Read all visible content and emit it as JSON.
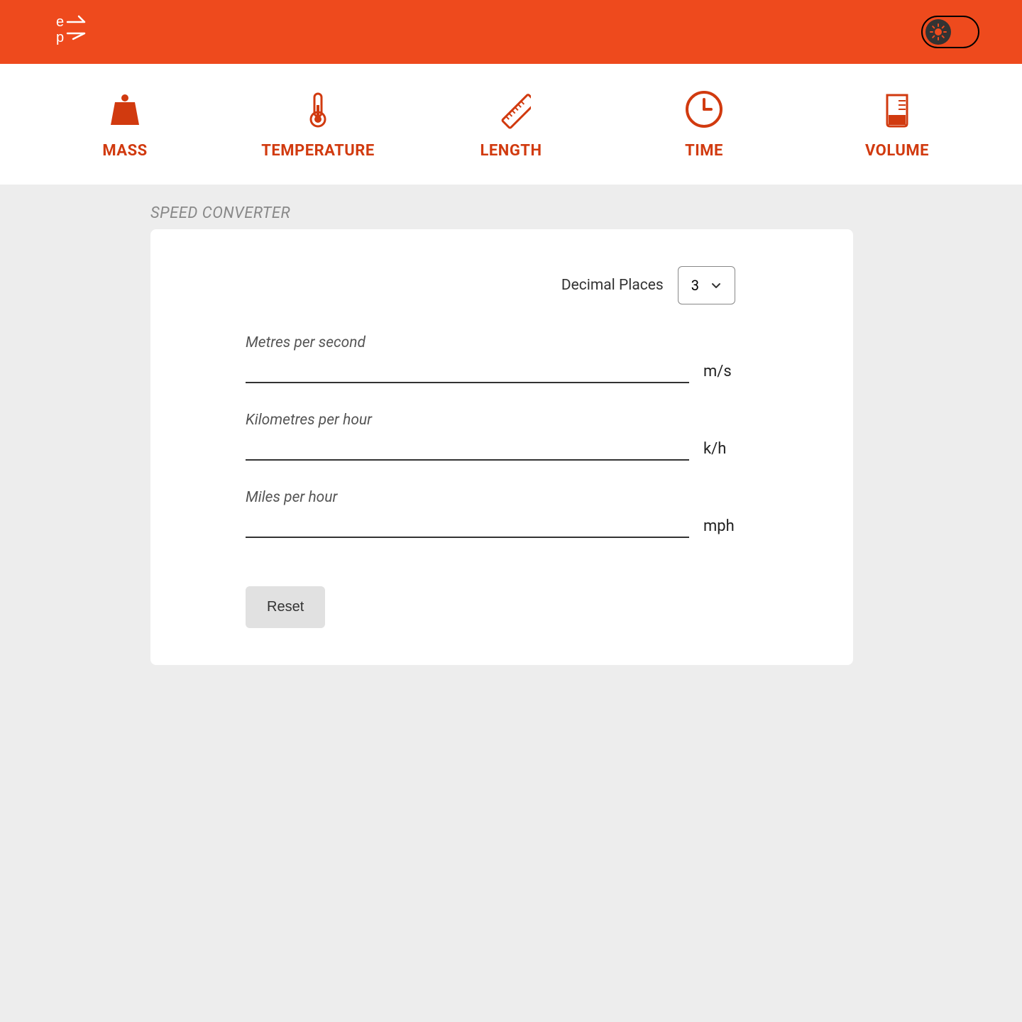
{
  "nav": {
    "items": [
      {
        "label": "MASS"
      },
      {
        "label": "TEMPERATURE"
      },
      {
        "label": "LENGTH"
      },
      {
        "label": "TIME"
      },
      {
        "label": "VOLUME"
      }
    ]
  },
  "section": {
    "title": "SPEED CONVERTER"
  },
  "decimal": {
    "label": "Decimal Places",
    "value": "3"
  },
  "fields": [
    {
      "label": "Metres per second",
      "unit": "m/s"
    },
    {
      "label": "Kilometres per hour",
      "unit": "k/h"
    },
    {
      "label": "Miles per hour",
      "unit": "mph"
    }
  ],
  "buttons": {
    "reset": "Reset"
  }
}
